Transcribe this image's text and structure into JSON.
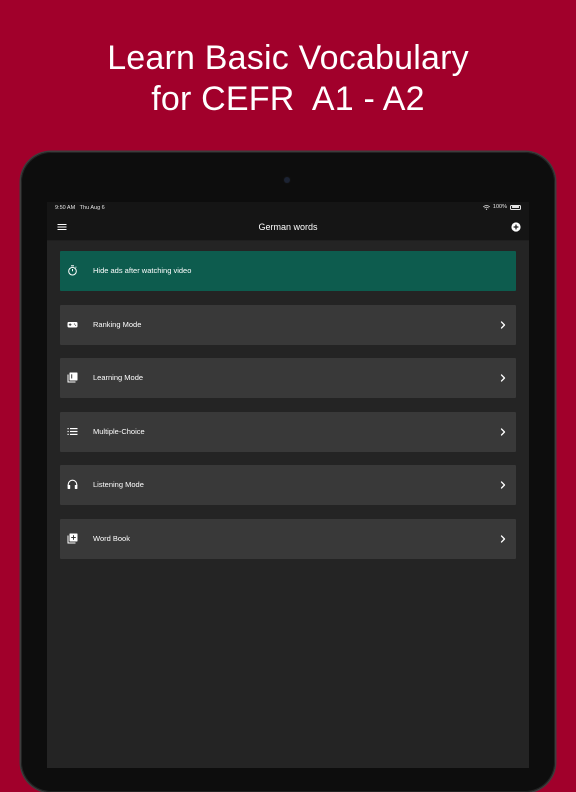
{
  "promo": {
    "line1": "Learn Basic Vocabulary",
    "line2": "for CEFR  A1 - A2"
  },
  "status_bar": {
    "time": "9:50 AM   Thu Aug 6",
    "battery": "100%"
  },
  "nav": {
    "title": "German words"
  },
  "menu": [
    {
      "label": "Hide ads after watching video",
      "icon": "stopwatch-icon"
    },
    {
      "label": "Ranking Mode",
      "icon": "gamepad-icon"
    },
    {
      "label": "Learning Mode",
      "icon": "library-icon"
    },
    {
      "label": "Multiple-Choice",
      "icon": "list-icon"
    },
    {
      "label": "Listening Mode",
      "icon": "headphones-icon"
    },
    {
      "label": "Word Book",
      "icon": "add-to-library-icon"
    }
  ],
  "colors": {
    "background": "#a1002b",
    "promo_row": "#0d5c4e",
    "row": "#393939",
    "screen": "#242424"
  }
}
